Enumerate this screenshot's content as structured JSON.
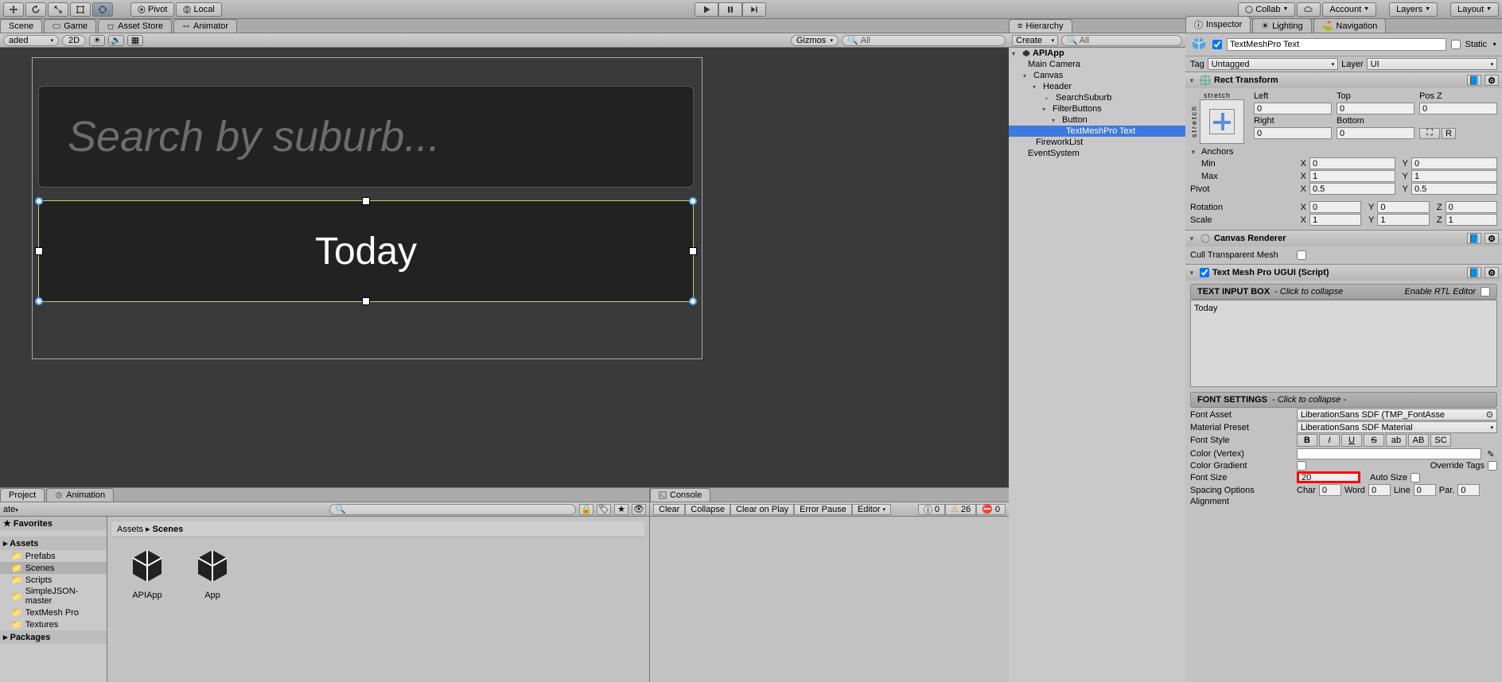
{
  "topbar": {
    "pivot": "Pivot",
    "local": "Local",
    "collab": "Collab",
    "account": "Account",
    "layers": "Layers",
    "layout": "Layout"
  },
  "scene": {
    "tabs": {
      "scene": "Scene",
      "game": "Game",
      "asset_store": "Asset Store",
      "animator": "Animator"
    },
    "toolbar": {
      "shaded": "aded",
      "mode2d": "2D",
      "gizmos": "Gizmos",
      "search_placeholder": "All"
    },
    "canvas": {
      "search_placeholder": "Search by suburb...",
      "today_text": "Today"
    }
  },
  "hierarchy": {
    "title": "Hierarchy",
    "create": "Create",
    "search_placeholder": "All",
    "items": [
      "APIApp",
      "Main Camera",
      "Canvas",
      "Header",
      "SearchSuburb",
      "FilterButtons",
      "Button",
      "TextMeshPro Text",
      "FireworkList",
      "EventSystem"
    ]
  },
  "inspector": {
    "title": "Inspector",
    "lighting": "Lighting",
    "navigation": "Navigation",
    "obj_name": "TextMeshPro Text",
    "static": "Static",
    "tag": "Tag",
    "tag_value": "Untagged",
    "layer": "Layer",
    "layer_value": "UI",
    "rect": {
      "title": "Rect Transform",
      "stretch": "stretch",
      "left": "Left",
      "top": "Top",
      "posz": "Pos Z",
      "right": "Right",
      "bottom": "Bottom",
      "left_v": "0",
      "top_v": "0",
      "posz_v": "0",
      "right_v": "0",
      "bottom_v": "0",
      "btn_full": "⛶",
      "btn_r": "R",
      "anchors": "Anchors",
      "min": "Min",
      "max": "Max",
      "pivot": "Pivot",
      "rotation": "Rotation",
      "scale": "Scale",
      "min_x": "0",
      "min_y": "0",
      "max_x": "1",
      "max_y": "1",
      "pivot_x": "0.5",
      "pivot_y": "0.5",
      "rot_x": "0",
      "rot_y": "0",
      "rot_z": "0",
      "scl_x": "1",
      "scl_y": "1",
      "scl_z": "1"
    },
    "canvas_renderer": {
      "title": "Canvas Renderer",
      "cull": "Cull Transparent Mesh"
    },
    "tmp": {
      "title": "Text Mesh Pro UGUI (Script)",
      "input_box": "TEXT INPUT BOX",
      "input_hint": "- Click to collapse",
      "rtl": "Enable RTL Editor",
      "text": "Today",
      "font_settings": "FONT SETTINGS",
      "fs_hint": "- Click to collapse -",
      "font_asset": "Font Asset",
      "font_asset_v": "LiberationSans SDF (TMP_FontAsse",
      "material": "Material Preset",
      "material_v": "LiberationSans SDF Material",
      "font_style": "Font Style",
      "styles": [
        "B",
        "I",
        "U",
        "S",
        "ab",
        "AB",
        "SC"
      ],
      "color": "Color (Vertex)",
      "gradient": "Color Gradient",
      "override": "Override Tags",
      "font_size": "Font Size",
      "font_size_v": "20",
      "auto_size": "Auto Size",
      "spacing": "Spacing Options",
      "char": "Char",
      "word": "Word",
      "line": "Line",
      "par": "Par.",
      "char_v": "0",
      "word_v": "0",
      "line_v": "0",
      "par_v": "0",
      "alignment": "Alignment"
    }
  },
  "project": {
    "tabs": {
      "project": "Project",
      "animation": "Animation"
    },
    "create": "ate",
    "breadcrumb": {
      "root": "Assets",
      "current": "Scenes"
    },
    "folders": {
      "fav": "Favorites",
      "assets": "Assets",
      "prefabs": "Prefabs",
      "scenes": "Scenes",
      "scripts": "Scripts",
      "json": "SimpleJSON-master",
      "tmp": "TextMesh Pro",
      "tex": "Textures",
      "packages": "Packages"
    },
    "assets": [
      "APIApp",
      "App"
    ]
  },
  "console": {
    "title": "Console",
    "buttons": {
      "clear": "Clear",
      "collapse": "Collapse",
      "clearplay": "Clear on Play",
      "errpause": "Error Pause",
      "editor": "Editor"
    },
    "counts": {
      "info": "0",
      "warn": "26",
      "err": "0"
    }
  }
}
